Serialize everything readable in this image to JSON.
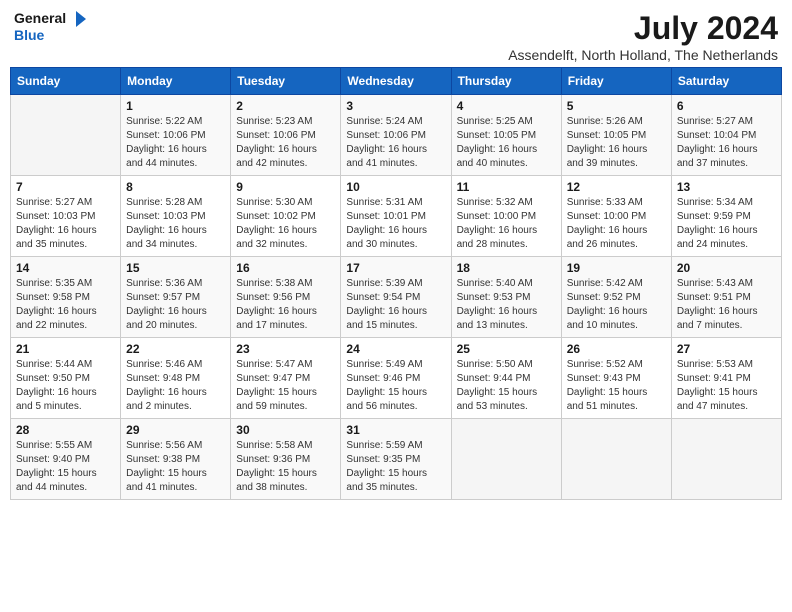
{
  "logo": {
    "line1": "General",
    "line2": "Blue"
  },
  "header": {
    "month": "July 2024",
    "location": "Assendelft, North Holland, The Netherlands"
  },
  "columns": [
    "Sunday",
    "Monday",
    "Tuesday",
    "Wednesday",
    "Thursday",
    "Friday",
    "Saturday"
  ],
  "weeks": [
    [
      {
        "day": "",
        "info": ""
      },
      {
        "day": "1",
        "info": "Sunrise: 5:22 AM\nSunset: 10:06 PM\nDaylight: 16 hours\nand 44 minutes."
      },
      {
        "day": "2",
        "info": "Sunrise: 5:23 AM\nSunset: 10:06 PM\nDaylight: 16 hours\nand 42 minutes."
      },
      {
        "day": "3",
        "info": "Sunrise: 5:24 AM\nSunset: 10:06 PM\nDaylight: 16 hours\nand 41 minutes."
      },
      {
        "day": "4",
        "info": "Sunrise: 5:25 AM\nSunset: 10:05 PM\nDaylight: 16 hours\nand 40 minutes."
      },
      {
        "day": "5",
        "info": "Sunrise: 5:26 AM\nSunset: 10:05 PM\nDaylight: 16 hours\nand 39 minutes."
      },
      {
        "day": "6",
        "info": "Sunrise: 5:27 AM\nSunset: 10:04 PM\nDaylight: 16 hours\nand 37 minutes."
      }
    ],
    [
      {
        "day": "7",
        "info": "Sunrise: 5:27 AM\nSunset: 10:03 PM\nDaylight: 16 hours\nand 35 minutes."
      },
      {
        "day": "8",
        "info": "Sunrise: 5:28 AM\nSunset: 10:03 PM\nDaylight: 16 hours\nand 34 minutes."
      },
      {
        "day": "9",
        "info": "Sunrise: 5:30 AM\nSunset: 10:02 PM\nDaylight: 16 hours\nand 32 minutes."
      },
      {
        "day": "10",
        "info": "Sunrise: 5:31 AM\nSunset: 10:01 PM\nDaylight: 16 hours\nand 30 minutes."
      },
      {
        "day": "11",
        "info": "Sunrise: 5:32 AM\nSunset: 10:00 PM\nDaylight: 16 hours\nand 28 minutes."
      },
      {
        "day": "12",
        "info": "Sunrise: 5:33 AM\nSunset: 10:00 PM\nDaylight: 16 hours\nand 26 minutes."
      },
      {
        "day": "13",
        "info": "Sunrise: 5:34 AM\nSunset: 9:59 PM\nDaylight: 16 hours\nand 24 minutes."
      }
    ],
    [
      {
        "day": "14",
        "info": "Sunrise: 5:35 AM\nSunset: 9:58 PM\nDaylight: 16 hours\nand 22 minutes."
      },
      {
        "day": "15",
        "info": "Sunrise: 5:36 AM\nSunset: 9:57 PM\nDaylight: 16 hours\nand 20 minutes."
      },
      {
        "day": "16",
        "info": "Sunrise: 5:38 AM\nSunset: 9:56 PM\nDaylight: 16 hours\nand 17 minutes."
      },
      {
        "day": "17",
        "info": "Sunrise: 5:39 AM\nSunset: 9:54 PM\nDaylight: 16 hours\nand 15 minutes."
      },
      {
        "day": "18",
        "info": "Sunrise: 5:40 AM\nSunset: 9:53 PM\nDaylight: 16 hours\nand 13 minutes."
      },
      {
        "day": "19",
        "info": "Sunrise: 5:42 AM\nSunset: 9:52 PM\nDaylight: 16 hours\nand 10 minutes."
      },
      {
        "day": "20",
        "info": "Sunrise: 5:43 AM\nSunset: 9:51 PM\nDaylight: 16 hours\nand 7 minutes."
      }
    ],
    [
      {
        "day": "21",
        "info": "Sunrise: 5:44 AM\nSunset: 9:50 PM\nDaylight: 16 hours\nand 5 minutes."
      },
      {
        "day": "22",
        "info": "Sunrise: 5:46 AM\nSunset: 9:48 PM\nDaylight: 16 hours\nand 2 minutes."
      },
      {
        "day": "23",
        "info": "Sunrise: 5:47 AM\nSunset: 9:47 PM\nDaylight: 15 hours\nand 59 minutes."
      },
      {
        "day": "24",
        "info": "Sunrise: 5:49 AM\nSunset: 9:46 PM\nDaylight: 15 hours\nand 56 minutes."
      },
      {
        "day": "25",
        "info": "Sunrise: 5:50 AM\nSunset: 9:44 PM\nDaylight: 15 hours\nand 53 minutes."
      },
      {
        "day": "26",
        "info": "Sunrise: 5:52 AM\nSunset: 9:43 PM\nDaylight: 15 hours\nand 51 minutes."
      },
      {
        "day": "27",
        "info": "Sunrise: 5:53 AM\nSunset: 9:41 PM\nDaylight: 15 hours\nand 47 minutes."
      }
    ],
    [
      {
        "day": "28",
        "info": "Sunrise: 5:55 AM\nSunset: 9:40 PM\nDaylight: 15 hours\nand 44 minutes."
      },
      {
        "day": "29",
        "info": "Sunrise: 5:56 AM\nSunset: 9:38 PM\nDaylight: 15 hours\nand 41 minutes."
      },
      {
        "day": "30",
        "info": "Sunrise: 5:58 AM\nSunset: 9:36 PM\nDaylight: 15 hours\nand 38 minutes."
      },
      {
        "day": "31",
        "info": "Sunrise: 5:59 AM\nSunset: 9:35 PM\nDaylight: 15 hours\nand 35 minutes."
      },
      {
        "day": "",
        "info": ""
      },
      {
        "day": "",
        "info": ""
      },
      {
        "day": "",
        "info": ""
      }
    ]
  ]
}
